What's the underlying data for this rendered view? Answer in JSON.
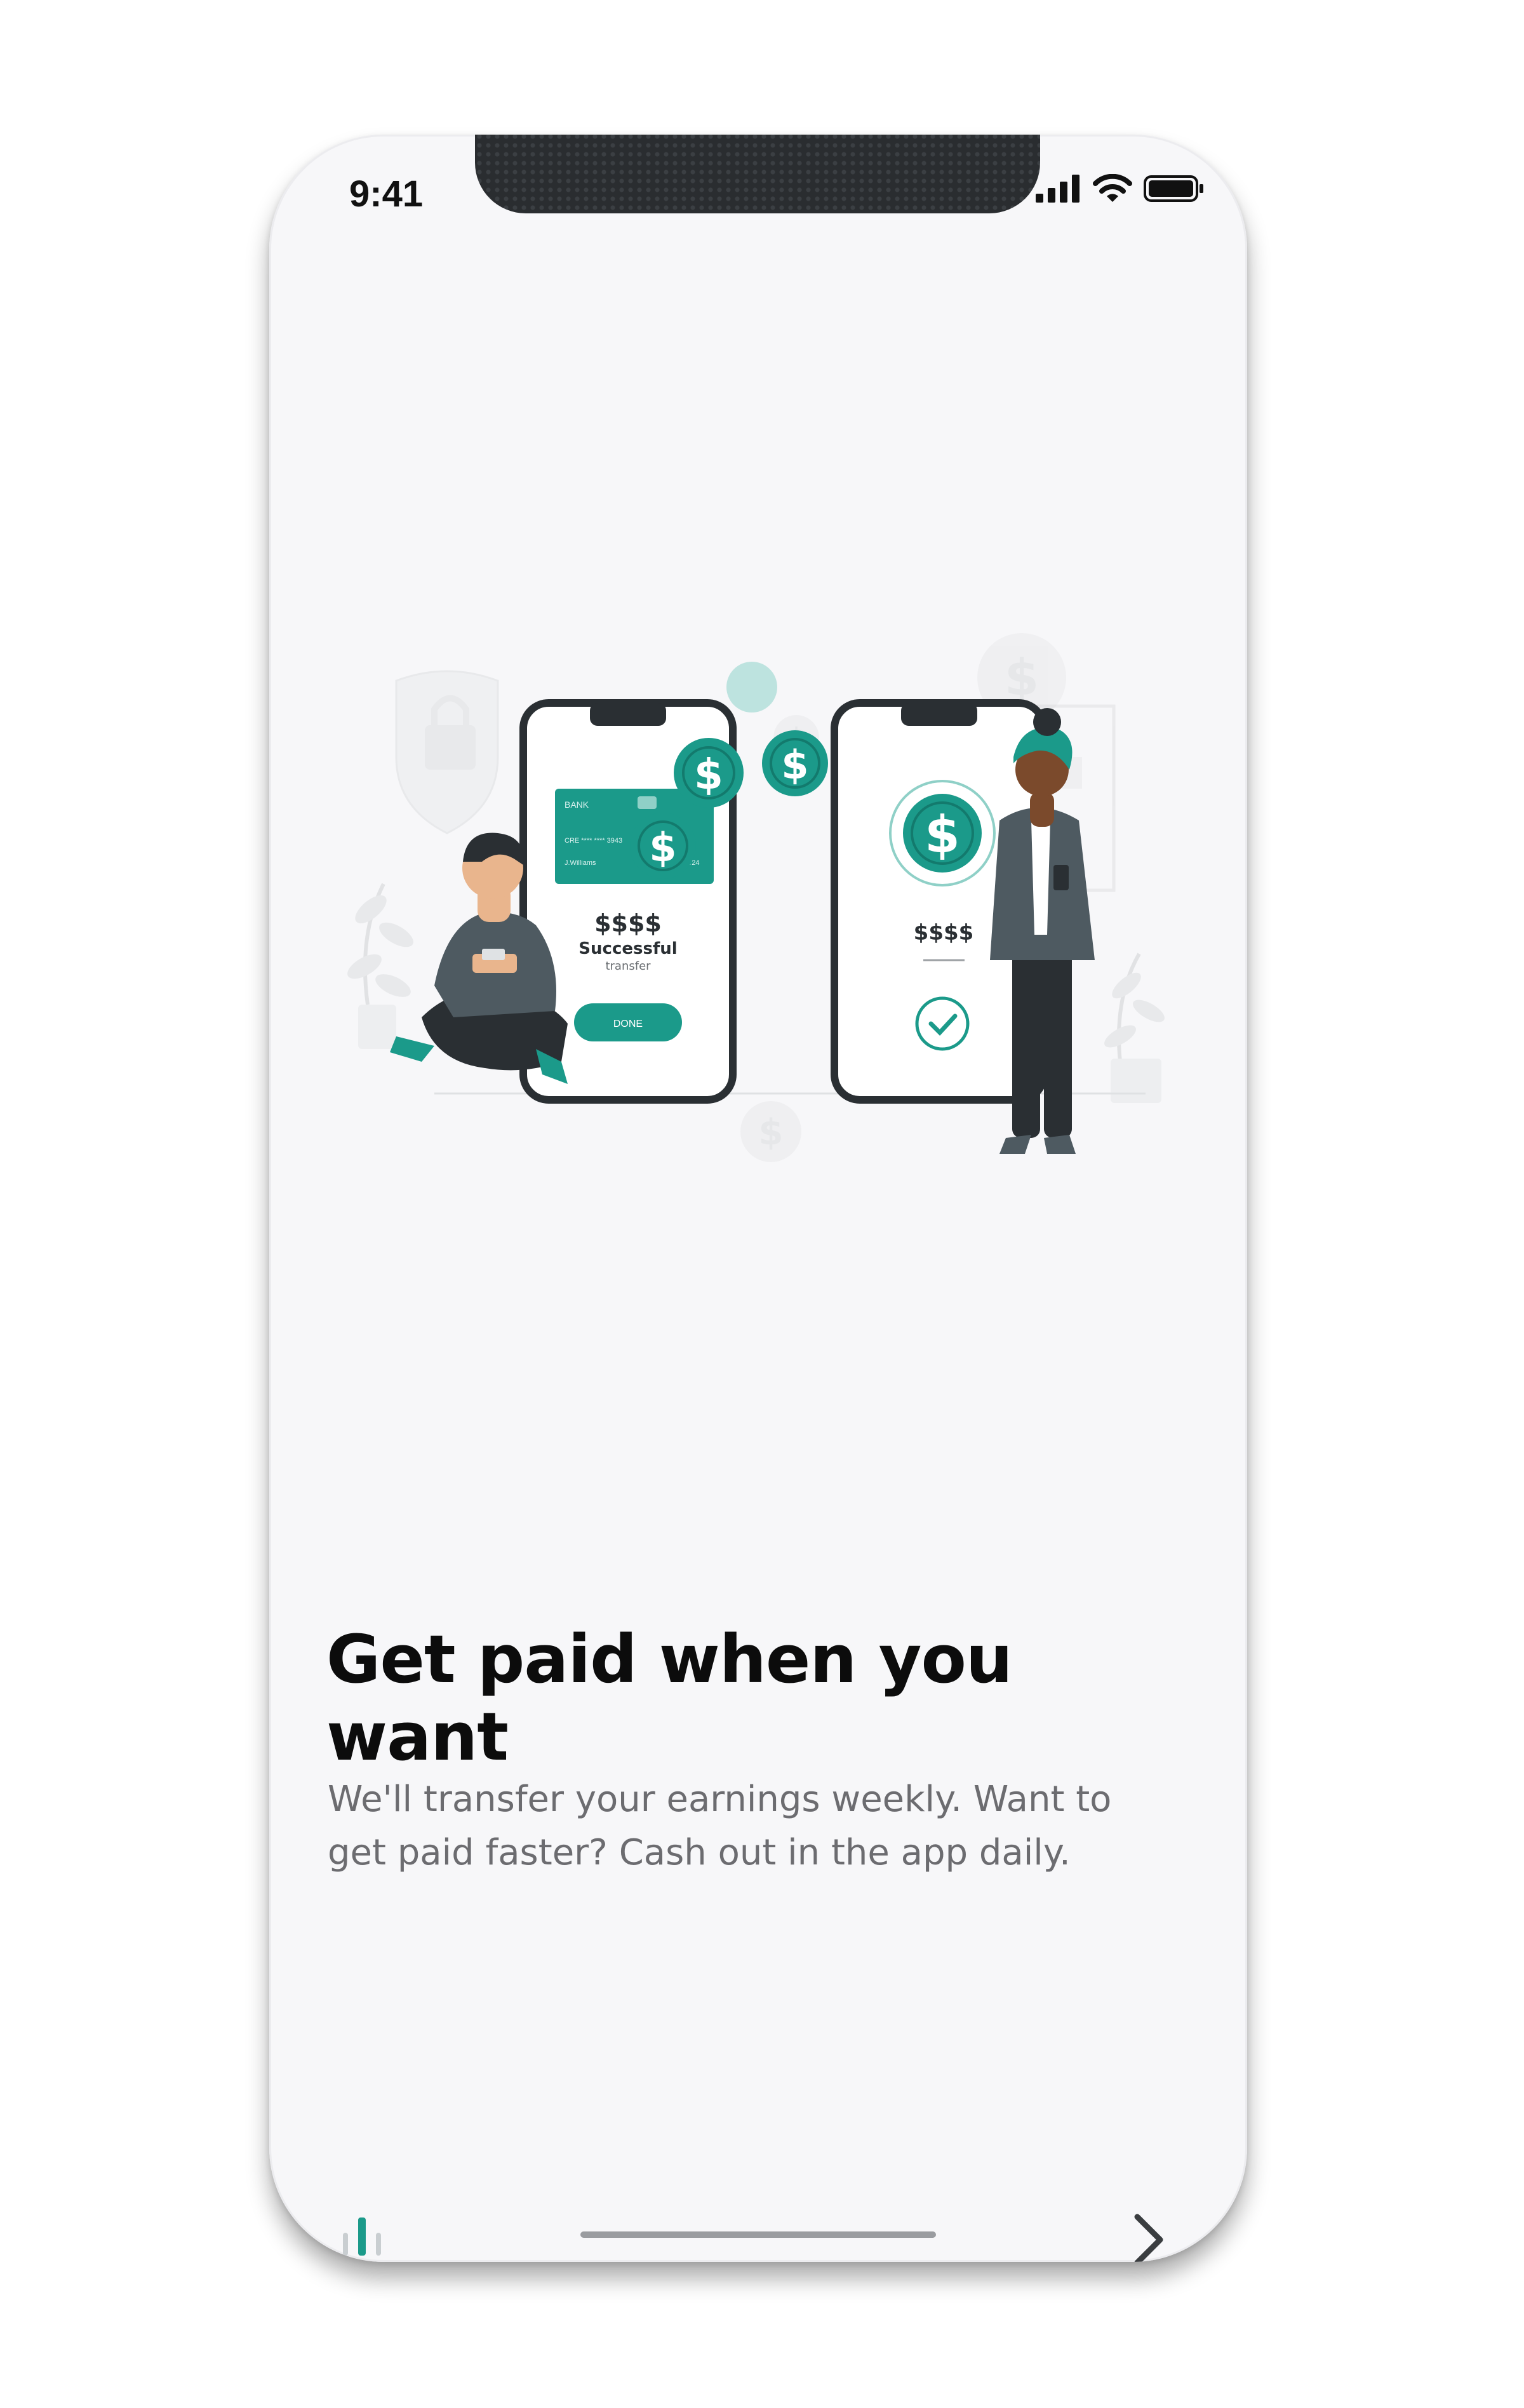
{
  "status_bar": {
    "time": "9:41"
  },
  "illustration": {
    "left_phone": {
      "card_bank": "BANK",
      "card_number": "CRE   ****   ****   3943",
      "card_holder": "J.Williams",
      "card_expiry": "06/24",
      "amount": "$$$$",
      "status": "Successful",
      "status_sub": "transfer",
      "button": "DONE"
    },
    "right_phone": {
      "amount": "$$$$"
    }
  },
  "onboarding": {
    "title": "Get paid when you want",
    "description": "We'll transfer your earnings weekly. Want to get paid faster? Cash out in the app daily."
  },
  "pager": {
    "current_page": 1
  },
  "colors": {
    "accent": "#1b9a8a",
    "phone_frame": "#2a2d30",
    "text_dark": "#0c0c0c",
    "text_muted": "#6c6c70"
  },
  "icons": {
    "next": "chevron-right-icon",
    "signal": "signal-icon",
    "wifi": "wifi-icon",
    "battery": "battery-icon"
  }
}
